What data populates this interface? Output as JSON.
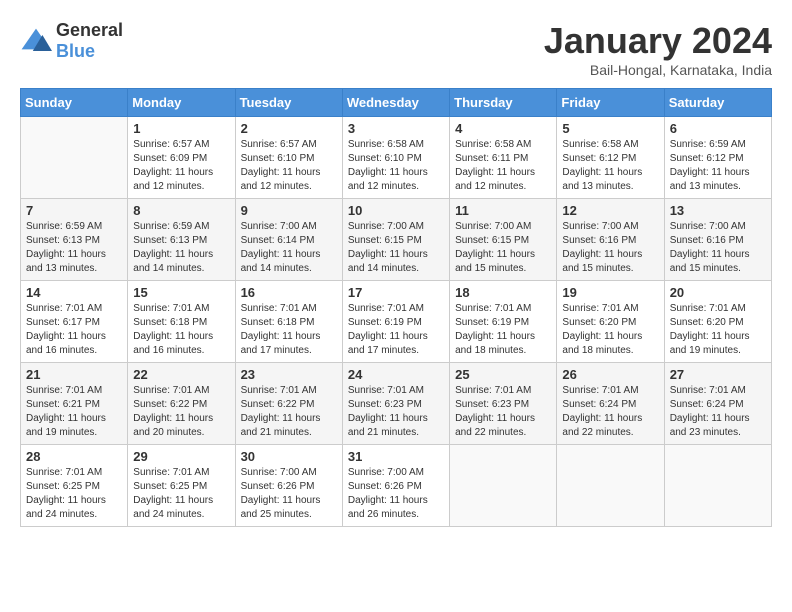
{
  "logo": {
    "general": "General",
    "blue": "Blue"
  },
  "title": "January 2024",
  "subtitle": "Bail-Hongal, Karnataka, India",
  "days_of_week": [
    "Sunday",
    "Monday",
    "Tuesday",
    "Wednesday",
    "Thursday",
    "Friday",
    "Saturday"
  ],
  "weeks": [
    [
      {
        "day": "",
        "info": ""
      },
      {
        "day": "1",
        "info": "Sunrise: 6:57 AM\nSunset: 6:09 PM\nDaylight: 11 hours\nand 12 minutes."
      },
      {
        "day": "2",
        "info": "Sunrise: 6:57 AM\nSunset: 6:10 PM\nDaylight: 11 hours\nand 12 minutes."
      },
      {
        "day": "3",
        "info": "Sunrise: 6:58 AM\nSunset: 6:10 PM\nDaylight: 11 hours\nand 12 minutes."
      },
      {
        "day": "4",
        "info": "Sunrise: 6:58 AM\nSunset: 6:11 PM\nDaylight: 11 hours\nand 12 minutes."
      },
      {
        "day": "5",
        "info": "Sunrise: 6:58 AM\nSunset: 6:12 PM\nDaylight: 11 hours\nand 13 minutes."
      },
      {
        "day": "6",
        "info": "Sunrise: 6:59 AM\nSunset: 6:12 PM\nDaylight: 11 hours\nand 13 minutes."
      }
    ],
    [
      {
        "day": "7",
        "info": "Sunrise: 6:59 AM\nSunset: 6:13 PM\nDaylight: 11 hours\nand 13 minutes."
      },
      {
        "day": "8",
        "info": "Sunrise: 6:59 AM\nSunset: 6:13 PM\nDaylight: 11 hours\nand 14 minutes."
      },
      {
        "day": "9",
        "info": "Sunrise: 7:00 AM\nSunset: 6:14 PM\nDaylight: 11 hours\nand 14 minutes."
      },
      {
        "day": "10",
        "info": "Sunrise: 7:00 AM\nSunset: 6:15 PM\nDaylight: 11 hours\nand 14 minutes."
      },
      {
        "day": "11",
        "info": "Sunrise: 7:00 AM\nSunset: 6:15 PM\nDaylight: 11 hours\nand 15 minutes."
      },
      {
        "day": "12",
        "info": "Sunrise: 7:00 AM\nSunset: 6:16 PM\nDaylight: 11 hours\nand 15 minutes."
      },
      {
        "day": "13",
        "info": "Sunrise: 7:00 AM\nSunset: 6:16 PM\nDaylight: 11 hours\nand 15 minutes."
      }
    ],
    [
      {
        "day": "14",
        "info": "Sunrise: 7:01 AM\nSunset: 6:17 PM\nDaylight: 11 hours\nand 16 minutes."
      },
      {
        "day": "15",
        "info": "Sunrise: 7:01 AM\nSunset: 6:18 PM\nDaylight: 11 hours\nand 16 minutes."
      },
      {
        "day": "16",
        "info": "Sunrise: 7:01 AM\nSunset: 6:18 PM\nDaylight: 11 hours\nand 17 minutes."
      },
      {
        "day": "17",
        "info": "Sunrise: 7:01 AM\nSunset: 6:19 PM\nDaylight: 11 hours\nand 17 minutes."
      },
      {
        "day": "18",
        "info": "Sunrise: 7:01 AM\nSunset: 6:19 PM\nDaylight: 11 hours\nand 18 minutes."
      },
      {
        "day": "19",
        "info": "Sunrise: 7:01 AM\nSunset: 6:20 PM\nDaylight: 11 hours\nand 18 minutes."
      },
      {
        "day": "20",
        "info": "Sunrise: 7:01 AM\nSunset: 6:20 PM\nDaylight: 11 hours\nand 19 minutes."
      }
    ],
    [
      {
        "day": "21",
        "info": "Sunrise: 7:01 AM\nSunset: 6:21 PM\nDaylight: 11 hours\nand 19 minutes."
      },
      {
        "day": "22",
        "info": "Sunrise: 7:01 AM\nSunset: 6:22 PM\nDaylight: 11 hours\nand 20 minutes."
      },
      {
        "day": "23",
        "info": "Sunrise: 7:01 AM\nSunset: 6:22 PM\nDaylight: 11 hours\nand 21 minutes."
      },
      {
        "day": "24",
        "info": "Sunrise: 7:01 AM\nSunset: 6:23 PM\nDaylight: 11 hours\nand 21 minutes."
      },
      {
        "day": "25",
        "info": "Sunrise: 7:01 AM\nSunset: 6:23 PM\nDaylight: 11 hours\nand 22 minutes."
      },
      {
        "day": "26",
        "info": "Sunrise: 7:01 AM\nSunset: 6:24 PM\nDaylight: 11 hours\nand 22 minutes."
      },
      {
        "day": "27",
        "info": "Sunrise: 7:01 AM\nSunset: 6:24 PM\nDaylight: 11 hours\nand 23 minutes."
      }
    ],
    [
      {
        "day": "28",
        "info": "Sunrise: 7:01 AM\nSunset: 6:25 PM\nDaylight: 11 hours\nand 24 minutes."
      },
      {
        "day": "29",
        "info": "Sunrise: 7:01 AM\nSunset: 6:25 PM\nDaylight: 11 hours\nand 24 minutes."
      },
      {
        "day": "30",
        "info": "Sunrise: 7:00 AM\nSunset: 6:26 PM\nDaylight: 11 hours\nand 25 minutes."
      },
      {
        "day": "31",
        "info": "Sunrise: 7:00 AM\nSunset: 6:26 PM\nDaylight: 11 hours\nand 26 minutes."
      },
      {
        "day": "",
        "info": ""
      },
      {
        "day": "",
        "info": ""
      },
      {
        "day": "",
        "info": ""
      }
    ]
  ]
}
